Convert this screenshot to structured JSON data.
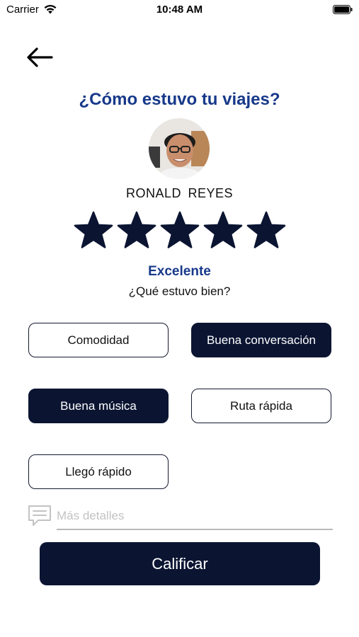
{
  "status_bar": {
    "carrier": "Carrier",
    "time": "10:48 AM",
    "icons": [
      "wifi-icon",
      "battery-icon"
    ]
  },
  "header": {
    "back_icon": "arrow-left-icon",
    "title": "¿Cómo estuvo tu viajes?"
  },
  "driver": {
    "name": "RONALD  REYES"
  },
  "rating": {
    "stars_filled": 5,
    "stars_total": 5,
    "label": "Excelente",
    "question": "¿Qué estuvo bien?"
  },
  "options": [
    {
      "label": "Comodidad",
      "selected": false
    },
    {
      "label": "Buena conversación",
      "selected": true
    },
    {
      "label": "Buena música",
      "selected": true
    },
    {
      "label": "Ruta rápida",
      "selected": false
    },
    {
      "label": "Llegó rápido",
      "selected": false
    }
  ],
  "details": {
    "icon": "comment-icon",
    "placeholder": "Más detalles",
    "value": ""
  },
  "submit": {
    "label": "Calificar"
  },
  "colors": {
    "accent": "#17398a",
    "dark": "#0b1532",
    "placeholder": "#c3c3c3"
  }
}
